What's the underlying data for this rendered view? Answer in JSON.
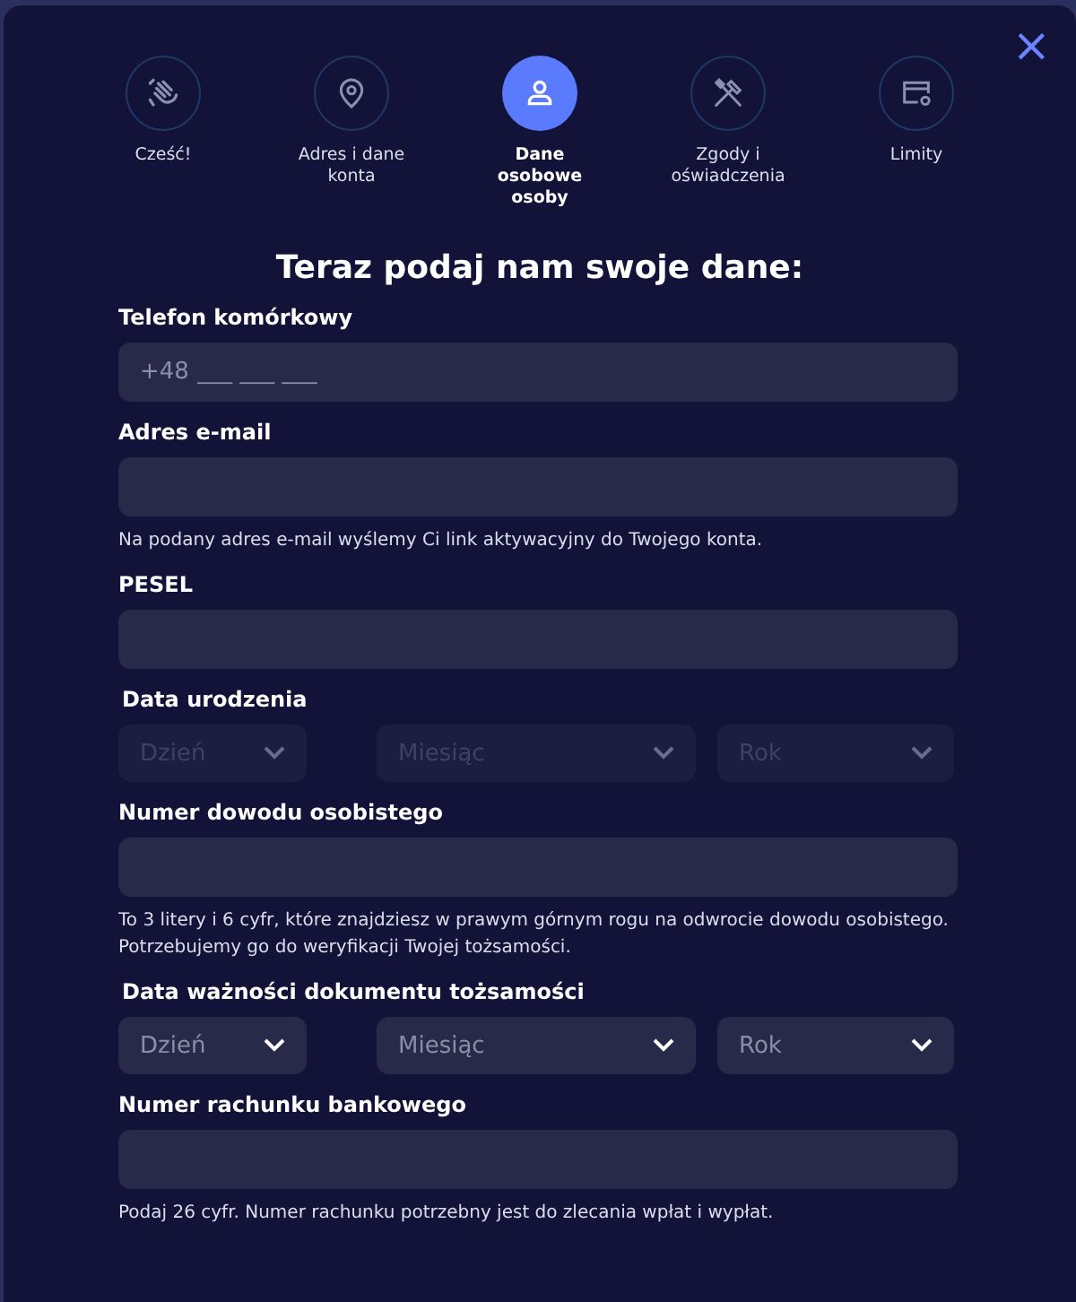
{
  "steps": [
    {
      "label": "Cześć!",
      "kind": "wave",
      "selected": false
    },
    {
      "label": "Adres i dane konta",
      "kind": "pin",
      "selected": false
    },
    {
      "label": "Dane osobowe osoby",
      "kind": "person",
      "selected": true
    },
    {
      "label": "Zgody i oświadczenia",
      "kind": "tools",
      "selected": false
    },
    {
      "label": "Limity",
      "kind": "card",
      "selected": false
    }
  ],
  "close": "×",
  "title": "Teraz podaj nam swoje dane:",
  "fields": [
    {
      "kind": "phone",
      "label": "Telefon komórkowy",
      "prefix": "+48",
      "placeholder": "___ ___ ___"
    },
    {
      "kind": "text",
      "label": "Adres e-mail",
      "help": [
        "Na podany adres e-mail wyślemy Ci link aktywacyjny do Twojego konta."
      ]
    },
    {
      "kind": "text",
      "label": "PESEL"
    },
    {
      "kind": "date",
      "label": "Data urodzenia",
      "disabled": true,
      "selects": [
        "Dzień",
        "Miesiąc",
        "Rok"
      ]
    },
    {
      "kind": "text",
      "label": "Numer dowodu osobistego",
      "help": [
        "To 3 litery i 6 cyfr, które znajdziesz w prawym górnym rogu na odwrocie dowodu osobistego.",
        "Potrzebujemy go do weryfikacji Twojej tożsamości."
      ]
    },
    {
      "kind": "date",
      "label": "Data ważności dokumentu tożsamości",
      "disabled": false,
      "selects": [
        "Dzień",
        "Miesiąc",
        "Rok"
      ]
    },
    {
      "kind": "text",
      "label": "Numer rachunku bankowego",
      "help": [
        "Podaj 26 cyfr. Numer rachunku potrzebny jest do zlecania wpłat i wypłat."
      ]
    }
  ]
}
